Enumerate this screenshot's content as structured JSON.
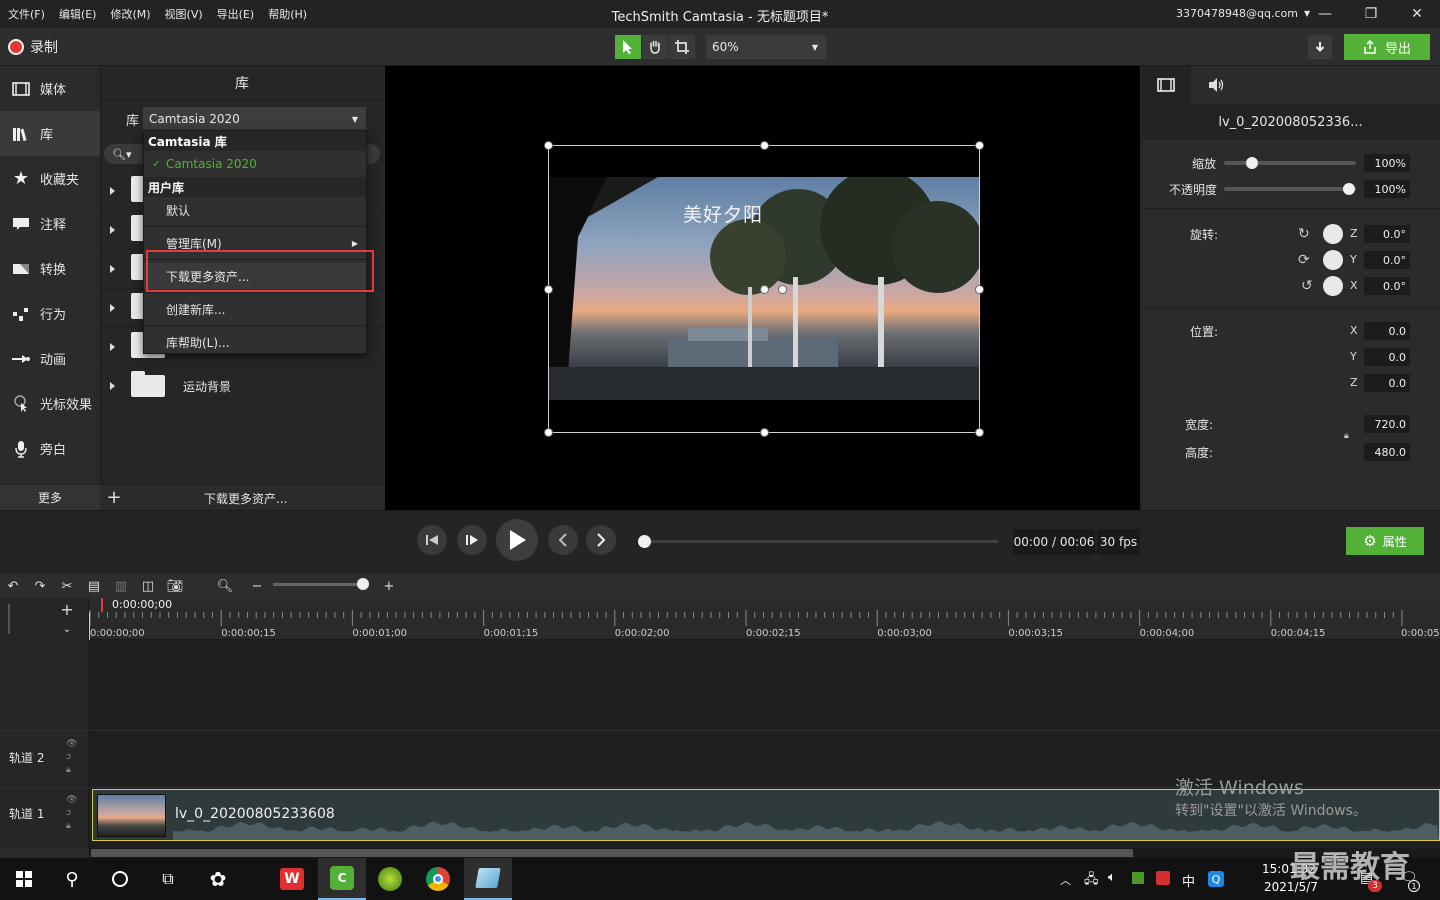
{
  "menu": [
    "文件(F)",
    "编辑(E)",
    "修改(M)",
    "视图(V)",
    "导出(E)",
    "帮助(H)"
  ],
  "title": "TechSmith Camtasia - 无标题项目*",
  "account": "3370478948@qq.com",
  "window_controls": {
    "minimize": "—",
    "maximize": "❐",
    "close": "✕"
  },
  "toolbar": {
    "record_label": "录制",
    "zoom": "60%",
    "export_label": "导出"
  },
  "nav": [
    {
      "label": "媒体",
      "icon": "film-icon"
    },
    {
      "label": "库",
      "icon": "library-icon"
    },
    {
      "label": "收藏夹",
      "icon": "star-icon"
    },
    {
      "label": "注释",
      "icon": "callout-icon"
    },
    {
      "label": "转换",
      "icon": "transition-icon"
    },
    {
      "label": "行为",
      "icon": "behavior-icon"
    },
    {
      "label": "动画",
      "icon": "animation-icon"
    },
    {
      "label": "光标效果",
      "icon": "cursor-icon"
    },
    {
      "label": "旁白",
      "icon": "mic-icon"
    }
  ],
  "nav_more": "更多",
  "library": {
    "title": "库",
    "label": "库",
    "selected": "Camtasia 2020",
    "rows": [
      "运动背景"
    ],
    "footer_add": "+",
    "footer_link": "下载更多资产..."
  },
  "dropdown": {
    "header1": "Camtasia 库",
    "checked_item": "Camtasia 2020",
    "header2": "用户库",
    "default": "默认",
    "manage": "管理库(M)",
    "download_more": "下载更多资产...",
    "create_new": "创建新库...",
    "help": "库帮助(L)..."
  },
  "preview": {
    "caption": "美好夕阳"
  },
  "properties": {
    "clip_name": "lv_0_202008052336...",
    "scale_label": "缩放",
    "scale": "100%",
    "opacity_label": "不透明度",
    "opacity": "100%",
    "rotation_label": "旋转:",
    "rot_z": "0.0°",
    "rot_y": "0.0°",
    "rot_x": "0.0°",
    "position_label": "位置:",
    "pos_x": "0.0",
    "pos_y": "0.0",
    "pos_z": "0.0",
    "width_label": "宽度:",
    "width": "720.0",
    "height_label": "高度:",
    "height": "480.0",
    "axis_x": "X",
    "axis_y": "Y",
    "axis_z": "Z"
  },
  "playback": {
    "timecode": "00:00 / 00:06",
    "fps": "30 fps",
    "props_button": "属性"
  },
  "timeline": {
    "playhead": "0:00:00;00",
    "ticks": [
      "0:00:00;00",
      "0:00:00;15",
      "0:00:01;00",
      "0:00:01;15",
      "0:00:02;00",
      "0:00:02;15",
      "0:00:03;00",
      "0:00:03;15",
      "0:00:04;00",
      "0:00:04;15",
      "0:00:05"
    ],
    "track2": "轨道 2",
    "track1": "轨道 1",
    "clip_name": "lv_0_20200805233608"
  },
  "watermark": {
    "line1": "激活 Windows",
    "line2": "转到\"设置\"以激活 Windows。"
  },
  "taskbar": {
    "time": "15:01:32",
    "date": "2021/5/7",
    "ime": "中",
    "badge": "3",
    "notif": "1"
  },
  "corner_watermark": "最需教育"
}
